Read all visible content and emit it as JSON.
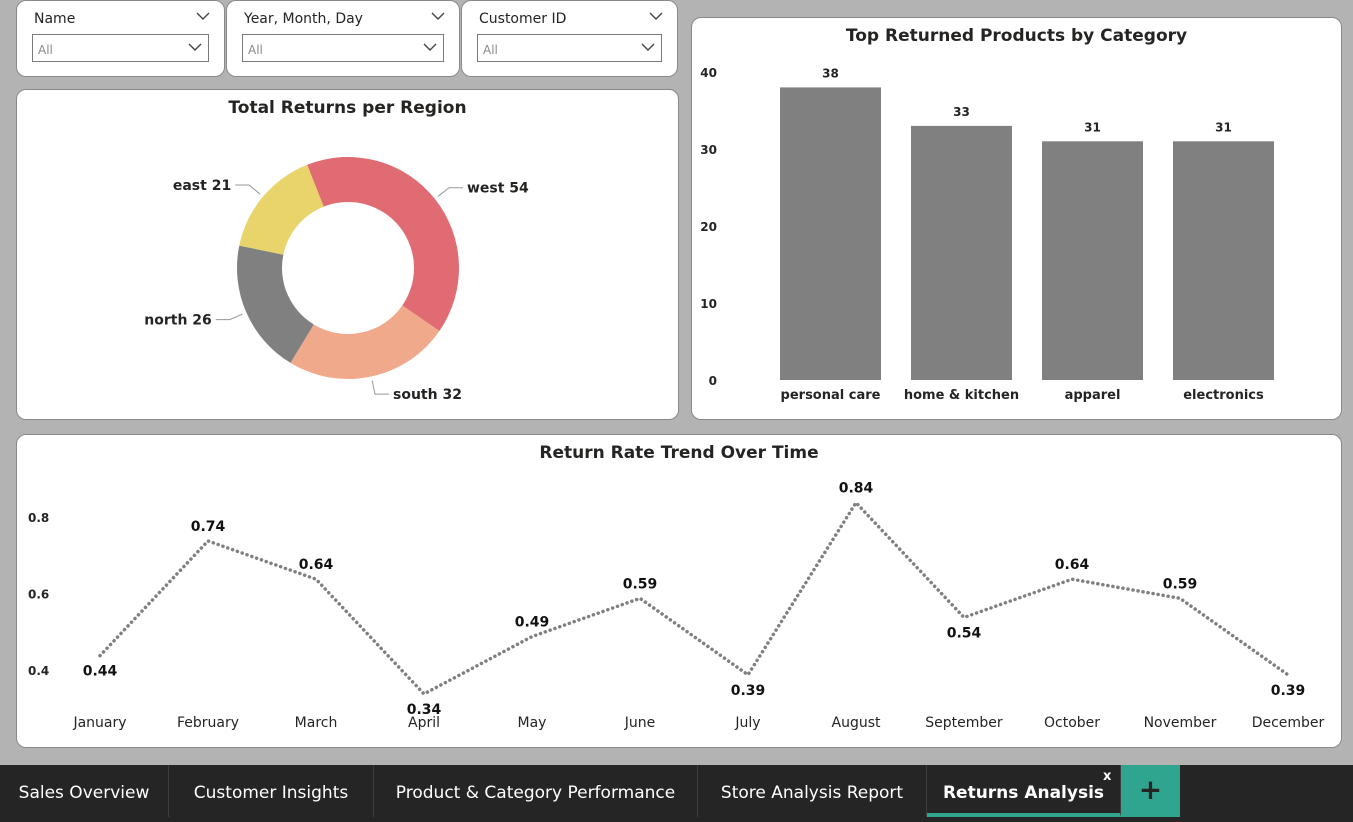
{
  "slicers": [
    {
      "label": "Name",
      "value": "All"
    },
    {
      "label": "Year, Month, Day",
      "value": "All"
    },
    {
      "label": "Customer ID",
      "value": "All"
    }
  ],
  "colors": {
    "east": "#e8d46a",
    "west": "#e06b73",
    "south": "#f0a98a",
    "north": "#808080",
    "bar": "#808080",
    "line": "#808080",
    "accent": "#2fa58f"
  },
  "charts": {
    "donut_title": "Total Returns per Region",
    "bar_title": "Top Returned Products by Category",
    "line_title": "Return Rate Trend Over Time"
  },
  "chart_data": [
    {
      "type": "pie",
      "title": "Total Returns per Region",
      "categories": [
        "east",
        "west",
        "south",
        "north"
      ],
      "values": [
        21,
        54,
        32,
        26
      ],
      "labels": [
        "east 21",
        "west 54",
        "south 32",
        "north 26"
      ]
    },
    {
      "type": "bar",
      "title": "Top Returned Products by Category",
      "categories": [
        "personal care",
        "home & kitchen",
        "apparel",
        "electronics"
      ],
      "values": [
        38,
        33,
        31,
        31
      ],
      "ylim": [
        0,
        40
      ],
      "yticks": [
        "0",
        "10",
        "20",
        "30",
        "40"
      ],
      "value_labels": [
        "38",
        "33",
        "31",
        "31"
      ]
    },
    {
      "type": "line",
      "title": "Return Rate Trend Over Time",
      "categories": [
        "January",
        "February",
        "March",
        "April",
        "May",
        "June",
        "July",
        "August",
        "September",
        "October",
        "November",
        "December"
      ],
      "values": [
        0.44,
        0.74,
        0.64,
        0.34,
        0.49,
        0.59,
        0.39,
        0.84,
        0.54,
        0.64,
        0.59,
        0.39
      ],
      "value_labels": [
        "0.44",
        "0.74",
        "0.64",
        "0.34",
        "0.49",
        "0.59",
        "0.39",
        "0.84",
        "0.54",
        "0.64",
        "0.59",
        "0.39"
      ],
      "yticks": [
        "0.4",
        "0.6",
        "0.8"
      ],
      "ylim": [
        0.3,
        0.9
      ],
      "line_style": "dotted"
    }
  ],
  "tabs": [
    {
      "label": "Sales Overview",
      "active": false
    },
    {
      "label": "Customer Insights",
      "active": false
    },
    {
      "label": "Product & Category Performance",
      "active": false
    },
    {
      "label": "Store Analysis Report",
      "active": false
    },
    {
      "label": "Returns Analysis",
      "active": true
    }
  ],
  "tab_close": "x",
  "add_tab": "+"
}
